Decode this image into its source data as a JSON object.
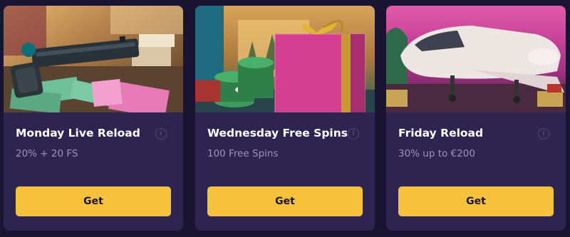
{
  "promotions": [
    {
      "title": "Monday Live Reload",
      "subtitle": "20% + 20 FS",
      "button_label": "Get",
      "info_icon": "info-icon"
    },
    {
      "title": "Wednesday Free Spins",
      "subtitle": "100 Free Spins",
      "button_label": "Get",
      "info_icon": "info-icon"
    },
    {
      "title": "Friday Reload",
      "subtitle": "30% up to €200",
      "button_label": "Get",
      "info_icon": "info-icon"
    }
  ],
  "colors": {
    "page_bg": "#1a1433",
    "card_bg": "#2d2550",
    "button_bg": "#f6c23e",
    "title_text": "#ffffff",
    "subtitle_text": "#9a94b8"
  }
}
